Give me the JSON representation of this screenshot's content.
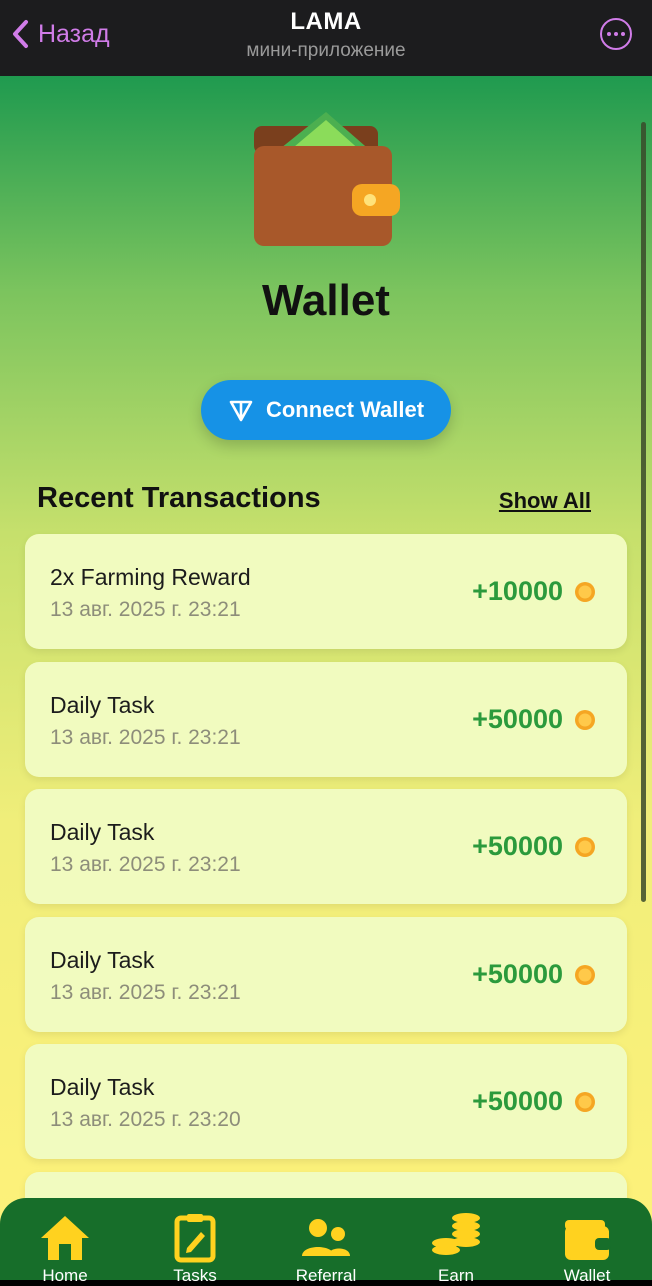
{
  "topbar": {
    "back_label": "Назад",
    "title": "LAMA",
    "subtitle": "мини-приложение"
  },
  "page": {
    "title": "Wallet",
    "connect_label": "Connect Wallet"
  },
  "transactions": {
    "section_title": "Recent Transactions",
    "show_all_label": "Show All",
    "items": [
      {
        "name": "2x Farming Reward",
        "date": "13 авг. 2025 г. 23:21",
        "amount": "+10000"
      },
      {
        "name": "Daily Task",
        "date": "13 авг. 2025 г. 23:21",
        "amount": "+50000"
      },
      {
        "name": "Daily Task",
        "date": "13 авг. 2025 г. 23:21",
        "amount": "+50000"
      },
      {
        "name": "Daily Task",
        "date": "13 авг. 2025 г. 23:21",
        "amount": "+50000"
      },
      {
        "name": "Daily Task",
        "date": "13 авг. 2025 г. 23:20",
        "amount": "+50000"
      }
    ]
  },
  "nav": {
    "items": [
      {
        "label": "Home",
        "icon": "home-icon"
      },
      {
        "label": "Tasks",
        "icon": "tasks-icon"
      },
      {
        "label": "Referral",
        "icon": "referral-icon"
      },
      {
        "label": "Earn",
        "icon": "coins-icon"
      },
      {
        "label": "Wallet",
        "icon": "wallet-icon"
      }
    ]
  },
  "colors": {
    "accent": "#d07ce8",
    "connect_button": "#1692e6",
    "amount_positive": "#2b9a3c",
    "nav_background": "#176e2a",
    "nav_icon": "#ffd21f",
    "card_background": "#f1fbbf"
  }
}
